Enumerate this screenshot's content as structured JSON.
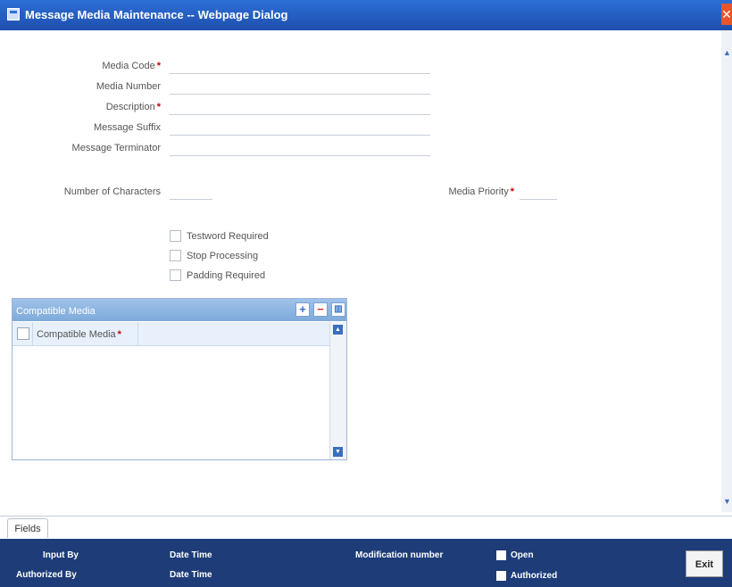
{
  "window": {
    "title": "Message Media Maintenance -- Webpage Dialog"
  },
  "form": {
    "media_code_label": "Media Code",
    "media_number_label": "Media Number",
    "description_label": "Description",
    "message_suffix_label": "Message Suffix",
    "message_terminator_label": "Message Terminator",
    "number_of_characters_label": "Number of Characters",
    "media_priority_label": "Media Priority",
    "required_mark": "*",
    "values": {
      "media_code": "",
      "media_number": "",
      "description": "",
      "message_suffix": "",
      "message_terminator": "",
      "number_of_characters": "",
      "media_priority": ""
    }
  },
  "checkboxes": {
    "testword": "Testword Required",
    "stop_processing": "Stop Processing",
    "padding": "Padding Required"
  },
  "grid": {
    "title": "Compatible Media",
    "add_icon": "+",
    "remove_icon": "−",
    "columns_icon": "columns-icon",
    "column": "Compatible Media",
    "rows": []
  },
  "tabs": {
    "fields": "Fields"
  },
  "footer": {
    "input_by": "Input By",
    "authorized_by": "Authorized By",
    "date_time_1": "Date Time",
    "date_time_2": "Date Time",
    "modification_number": "Modification number",
    "open": "Open",
    "authorized": "Authorized",
    "exit": "Exit"
  }
}
